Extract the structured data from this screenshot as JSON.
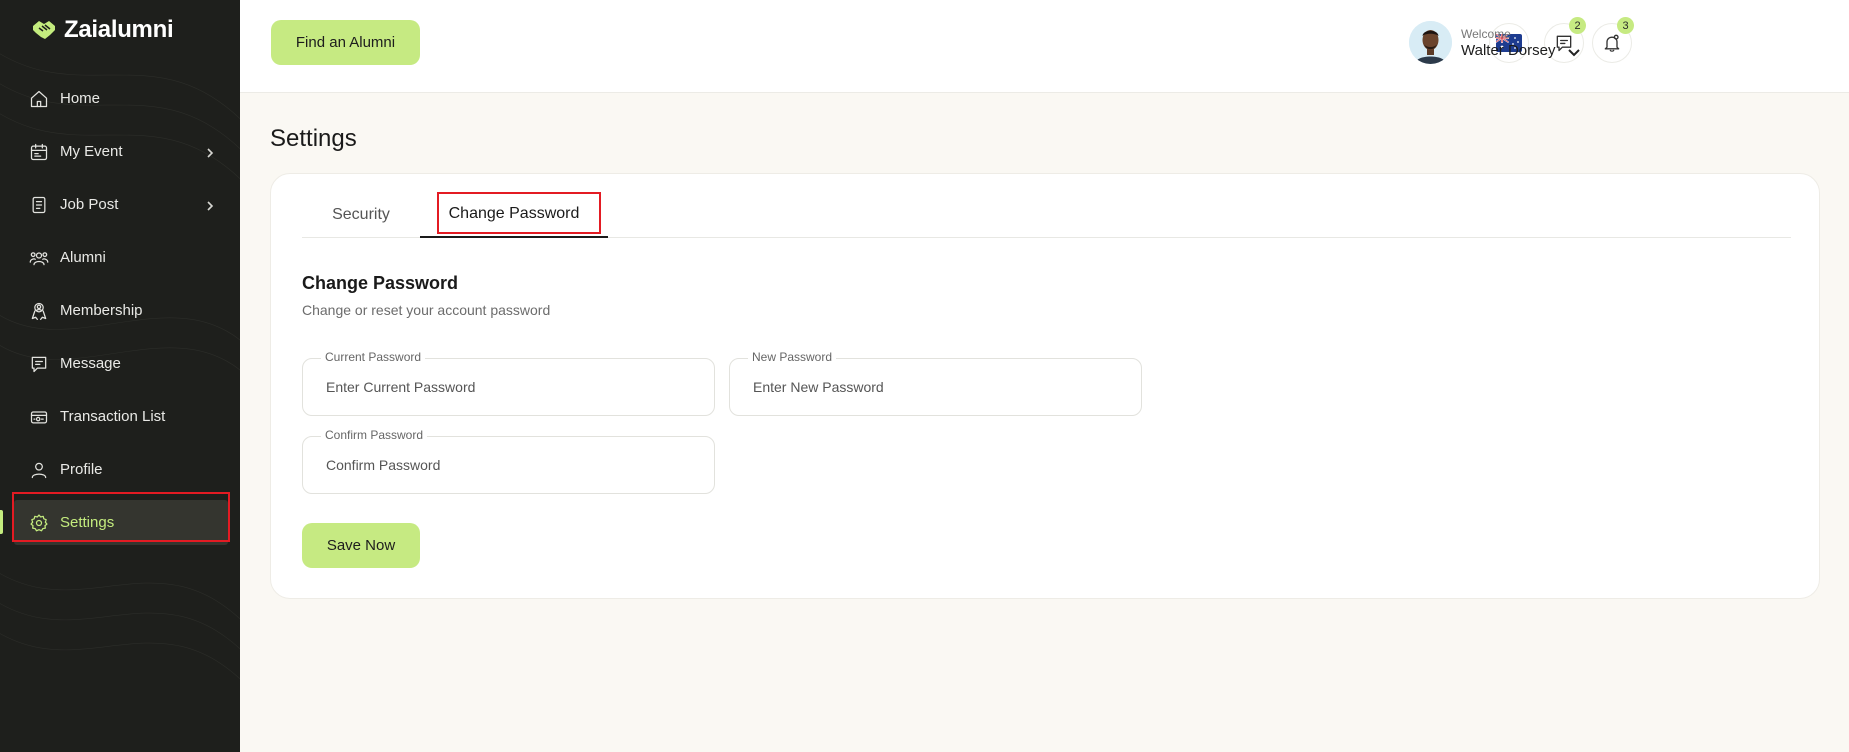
{
  "app": {
    "name": "Zaialumni"
  },
  "sidebar": {
    "items": [
      {
        "label": "Home",
        "icon": "home-icon"
      },
      {
        "label": "My Event",
        "icon": "calendar-icon",
        "has_submenu": true
      },
      {
        "label": "Job Post",
        "icon": "document-icon",
        "has_submenu": true
      },
      {
        "label": "Alumni",
        "icon": "users-icon"
      },
      {
        "label": "Membership",
        "icon": "badge-user-icon"
      },
      {
        "label": "Message",
        "icon": "message-icon"
      },
      {
        "label": "Transaction List",
        "icon": "wallet-icon"
      },
      {
        "label": "Profile",
        "icon": "user-icon"
      },
      {
        "label": "Settings",
        "icon": "gear-icon",
        "active": true
      }
    ]
  },
  "header": {
    "find_button": "Find an Alumni",
    "language_flag": "australia-flag-icon",
    "messages_count": "2",
    "notifications_count": "3",
    "welcome": "Welcome",
    "user_name": "Walter Dorsey"
  },
  "main": {
    "title": "Settings",
    "tabs": [
      {
        "label": "Security"
      },
      {
        "label": "Change Password",
        "active": true
      }
    ],
    "section_title": "Change Password",
    "section_subtitle": "Change or reset your account password",
    "fields": {
      "current": {
        "label": "Current Password",
        "placeholder": "Enter Current Password"
      },
      "new": {
        "label": "New Password",
        "placeholder": "Enter New Password"
      },
      "confirm": {
        "label": "Confirm Password",
        "placeholder": "Confirm Password"
      }
    },
    "save_button": "Save Now"
  },
  "colors": {
    "accent": "#c6ea82",
    "sidebar_bg": "#1e1f1c",
    "active_text": "#c4ec7e",
    "annotation_red": "#e31b23",
    "page_bg": "#faf8f3"
  }
}
